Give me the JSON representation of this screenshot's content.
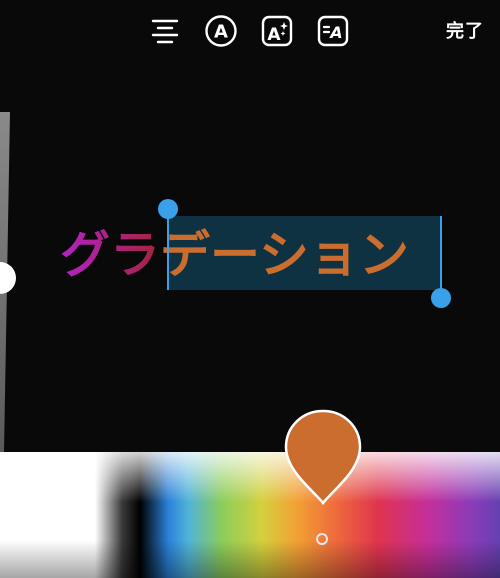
{
  "toolbar": {
    "done_label": "完了",
    "tools": [
      {
        "icon": "align-center-icon"
      },
      {
        "icon": "text-style-circle-icon"
      },
      {
        "icon": "text-effects-sparkle-icon"
      },
      {
        "icon": "text-animation-icon"
      }
    ]
  },
  "canvas": {
    "text_part_1": "グラ",
    "text_part_2": "デーション",
    "selected_text": "デーション"
  },
  "colors": {
    "selected_color": "#cb6d2e",
    "gradient_start": "#b522c9",
    "gradient_end": "#a2243a",
    "selection_handle": "#3aa0ea"
  },
  "icons": {
    "size_slider_thumb": "size-slider-thumb",
    "color_pin": "color-dropper-pin-icon"
  }
}
